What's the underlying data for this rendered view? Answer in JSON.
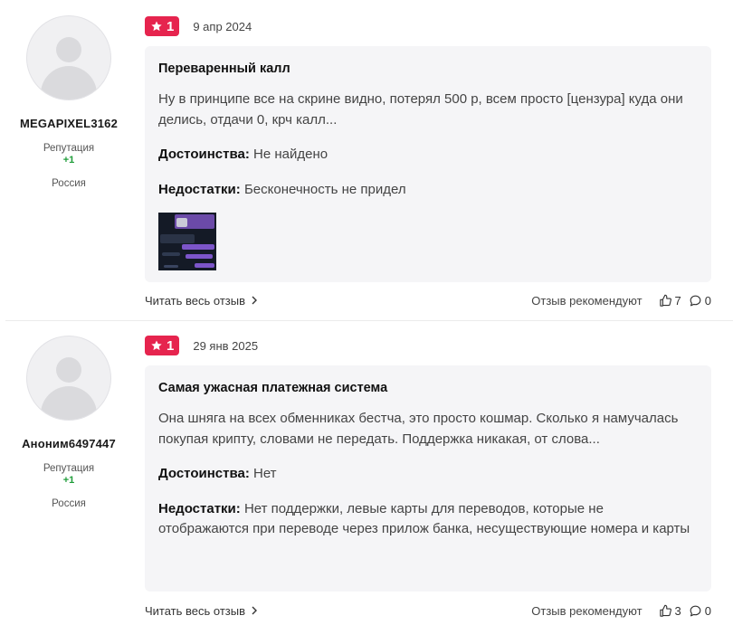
{
  "colors": {
    "badge": "#e6244e",
    "reputation": "#1f9d3a",
    "card_bg": "#f5f5f7"
  },
  "reviews": [
    {
      "user": {
        "name": "MEGAPIXEL3162",
        "reputation_label": "Репутация",
        "reputation_value": "+1",
        "country": "Россия"
      },
      "rating": "1",
      "date": "9 апр 2024",
      "title": "Переваренный калл",
      "text": "Ну в принципе все на скрине видно, потерял 500 р, всем просто [цензура] куда они делись, отдачи 0, крч калл...",
      "pros_label": "Достоинства:",
      "pros": "Не найдено",
      "cons_label": "Недостатки:",
      "cons": "Бесконечность не придел",
      "has_image": true,
      "read_more": "Читать весь отзыв",
      "recommend_label": "Отзыв рекомендуют",
      "likes": "7",
      "comments": "0"
    },
    {
      "user": {
        "name": "Аноним6497447",
        "reputation_label": "Репутация",
        "reputation_value": "+1",
        "country": "Россия"
      },
      "rating": "1",
      "date": "29 янв 2025",
      "title": "Самая ужасная платежная система",
      "text": "Она шняга на всех обменниках бестча, это просто кошмар. Сколько я намучалась покупая крипту, словами не передать. Поддержка никакая, от слова...",
      "pros_label": "Достоинства:",
      "pros": "Нет",
      "cons_label": "Недостатки:",
      "cons": "Нет поддержки, левые карты для переводов, которые не отображаются при переводе через прилож банка, несуществующие номера и карты",
      "has_image": false,
      "read_more": "Читать весь отзыв",
      "recommend_label": "Отзыв рекомендуют",
      "likes": "3",
      "comments": "0"
    }
  ]
}
